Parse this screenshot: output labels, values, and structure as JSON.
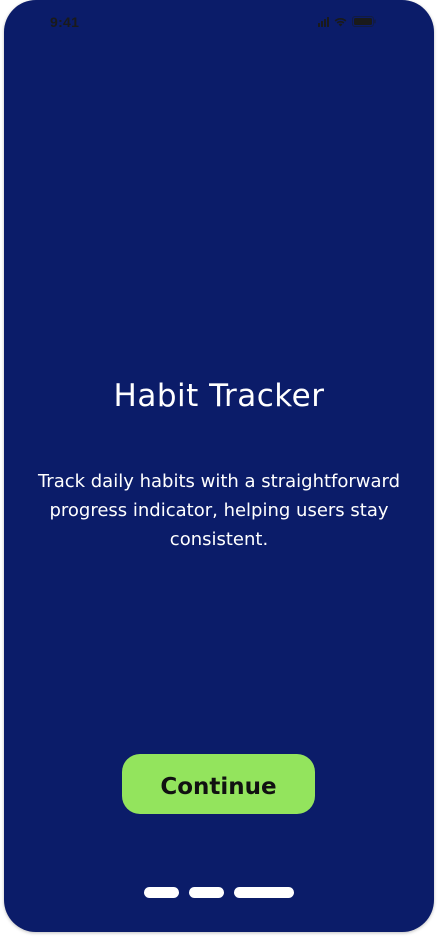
{
  "status_bar": {
    "time": "9:41",
    "icons": [
      "signal-icon",
      "wifi-icon",
      "battery-icon"
    ]
  },
  "screen": {
    "title": "Habit Tracker",
    "description": "Track daily habits with a straightforward progress indicator, helping users stay consistent.",
    "continue_label": "Continue"
  },
  "pager": {
    "page_count": 3,
    "active_page": 3
  },
  "colors": {
    "background": "#0b1c69",
    "accent": "#93e45d",
    "text": "#ffffff",
    "button_text": "#111111"
  }
}
